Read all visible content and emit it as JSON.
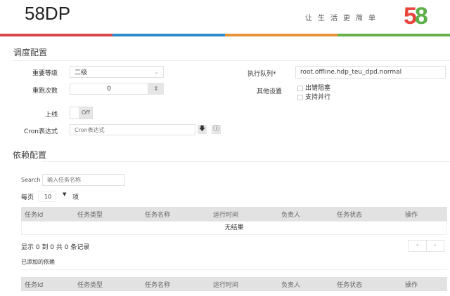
{
  "header": {
    "title": "58DP",
    "slogan": "让生活更简单",
    "logo": "58",
    "logo_colors": [
      "#e8453c",
      "#1a8fd6",
      "#f29a26",
      "#5bb04a"
    ]
  },
  "schedule": {
    "title": "调度配置",
    "priority": {
      "label": "重要等级",
      "value": "二级"
    },
    "retry": {
      "label": "重跑次数",
      "value": "0"
    },
    "online": {
      "label": "上线",
      "value": "Off"
    },
    "cron": {
      "label": "Cron表达式",
      "placeholder": "Cron表达式"
    },
    "queue": {
      "label": "执行队列*",
      "value": "root.offline.hdp_teu_dpd.normal"
    },
    "other": {
      "label": "其他设置",
      "options": [
        "出错阻塞",
        "支持并行"
      ]
    }
  },
  "deps": {
    "title": "依赖配置",
    "search_label": "Search",
    "search_placeholder": "输入任务名称",
    "per_page_label": "每页",
    "per_page_value": "10",
    "per_page_suffix": "项",
    "columns": [
      "任务Id",
      "任务类型",
      "任务名称",
      "运行时间",
      "负责人",
      "任务状态",
      "操作"
    ],
    "empty": "无结果",
    "summary": "显示 0 到 0 共 0 条记录",
    "prev": "‹",
    "next": "›",
    "added_title": "已添加的依赖"
  }
}
